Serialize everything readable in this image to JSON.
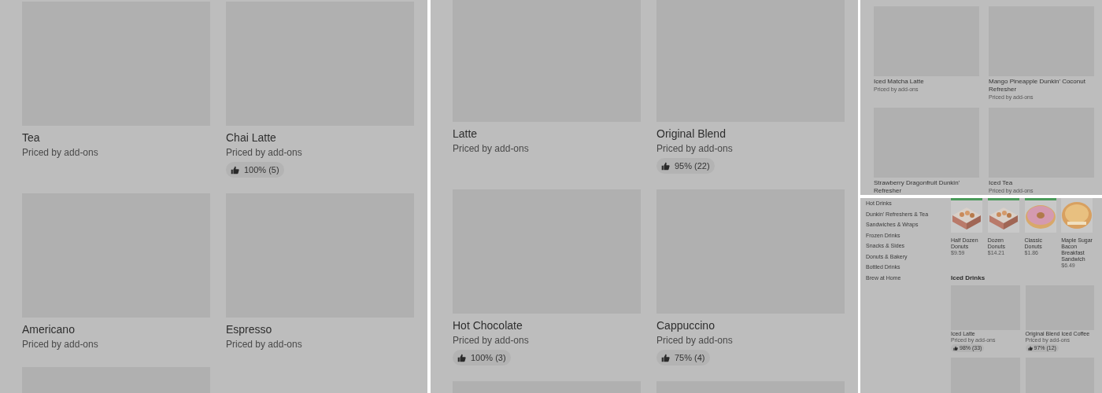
{
  "panel_a": {
    "cards": [
      {
        "kind": "item",
        "name": "Tea",
        "price": "Priced by add-ons"
      },
      {
        "kind": "item",
        "name": "Chai Latte",
        "price": "Priced by add-ons",
        "rating": "100% (5)"
      },
      {
        "kind": "item",
        "name": "Americano",
        "price": "Priced by add-ons"
      },
      {
        "kind": "item",
        "name": "Espresso",
        "price": "Priced by add-ons"
      },
      {
        "kind": "image-only"
      }
    ]
  },
  "panel_b": {
    "cards": [
      {
        "kind": "item",
        "name": "Latte",
        "price": "Priced by add-ons"
      },
      {
        "kind": "item",
        "name": "Original Blend",
        "price": "Priced by add-ons",
        "rating": "95% (22)"
      },
      {
        "kind": "item",
        "name": "Hot Chocolate",
        "price": "Priced by add-ons",
        "rating": "100% (3)"
      },
      {
        "kind": "item",
        "name": "Cappuccino",
        "price": "Priced by add-ons",
        "rating": "75% (4)"
      },
      {
        "kind": "image-only"
      },
      {
        "kind": "image-only"
      }
    ]
  },
  "panel_c": {
    "cards": [
      {
        "kind": "item",
        "name": "Iced Matcha Latte",
        "price": "Priced by add-ons"
      },
      {
        "kind": "item",
        "name": "Mango Pineapple Dunkin' Coconut Refresher",
        "price": "Priced by add-ons"
      },
      {
        "kind": "item",
        "name": "Strawberry Dragonfruit Dunkin' Refresher"
      },
      {
        "kind": "item",
        "name": "Iced Tea",
        "price": "Priced by add-ons"
      }
    ]
  },
  "panel_d": {
    "sidebar": {
      "items": [
        "Hot Drinks",
        "Dunkin' Refreshers & Tea",
        "Sandwiches & Wraps",
        "Frozen Drinks",
        "Snacks & Sides",
        "Donuts & Bakery",
        "Bottled Drinks",
        "Brew at Home"
      ]
    },
    "featured": [
      {
        "kind": "picture",
        "name": "Half Dozen Donuts",
        "price": "$9.59"
      },
      {
        "kind": "picture",
        "name": "Dozen Donuts",
        "price": "$14.21"
      },
      {
        "kind": "picture",
        "name": "Classic Donuts",
        "price": "$1.86"
      },
      {
        "kind": "picture",
        "name": "Maple Sugar Bacon Breakfast Sandwich",
        "price": "$6.49"
      }
    ],
    "section_title": "Iced Drinks",
    "cards": [
      {
        "kind": "item",
        "name": "Iced Latte",
        "price": "Priced by add-ons",
        "rating": "98% (33)"
      },
      {
        "kind": "item",
        "name": "Original Blend Iced Coffee",
        "price": "Priced by add-ons",
        "rating": "97% (12)"
      },
      {
        "kind": "image-only"
      },
      {
        "kind": "image-only"
      }
    ]
  }
}
